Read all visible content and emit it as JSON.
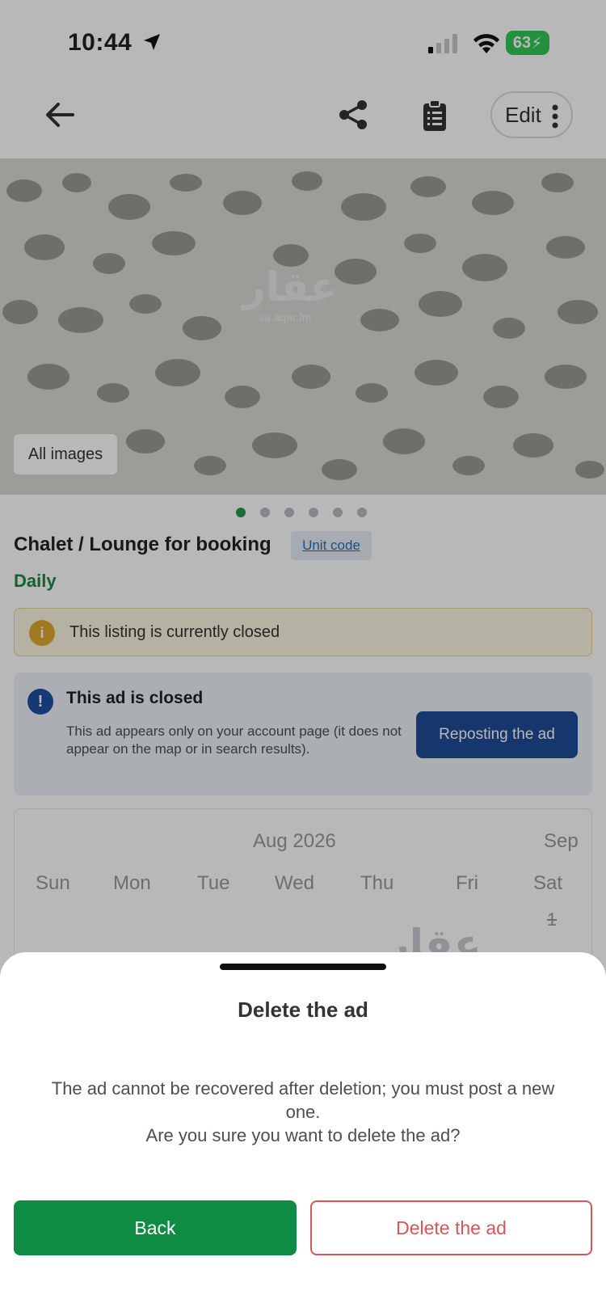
{
  "status_bar": {
    "time": "10:44",
    "battery": "63"
  },
  "header": {
    "edit_label": "Edit"
  },
  "hero": {
    "watermark_arabic": "عقار",
    "watermark_url": "sa.aqar.fm",
    "all_images_label": "All images",
    "dot_count": 6,
    "active_dot": 0
  },
  "listing": {
    "title": "Chalet / Lounge for booking",
    "unit_code_label": "Unit code",
    "price_period": "Daily"
  },
  "closed_banner": {
    "text": "This listing is currently closed"
  },
  "ad_closed": {
    "title": "This ad is closed",
    "description": "This ad appears only on your account page (it does not appear on the map or in search results).",
    "repost_label": "Reposting the ad"
  },
  "calendar": {
    "month": "Aug 2026",
    "next_month": "Sep",
    "weekdays": [
      "Sun",
      "Mon",
      "Tue",
      "Wed",
      "Thu",
      "Fri",
      "Sat"
    ],
    "first_date": "1",
    "watermark": "عقار"
  },
  "dialog": {
    "title": "Delete the ad",
    "message_line1": "The ad cannot be recovered after deletion; you must post a new one.",
    "message_line2": "Are you sure you want to delete the ad?",
    "back_label": "Back",
    "delete_label": "Delete the ad"
  },
  "colors": {
    "primary_green": "#0e8c44",
    "repost_blue": "#1f4b99",
    "danger_red": "#d9545b"
  }
}
